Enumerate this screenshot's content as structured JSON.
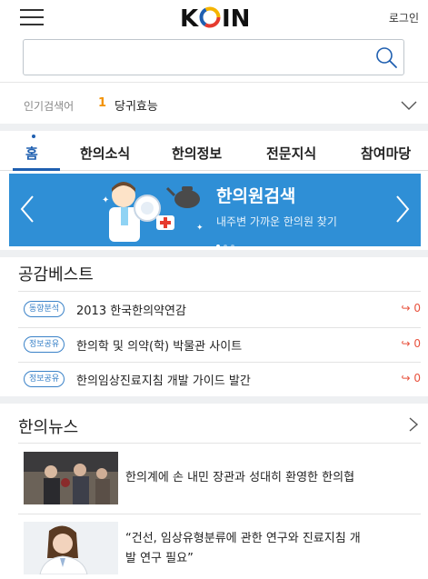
{
  "header": {
    "logo_text": "KOIN",
    "login_label": "로그인"
  },
  "search": {
    "value": "",
    "placeholder": ""
  },
  "popular": {
    "label": "인기검색어",
    "rank": "1",
    "term": "당귀효능"
  },
  "tabs": [
    {
      "label": "홈",
      "active": true
    },
    {
      "label": "한의소식"
    },
    {
      "label": "한의정보"
    },
    {
      "label": "전문지식"
    },
    {
      "label": "참여마당"
    }
  ],
  "banner": {
    "title": "한의원검색",
    "subtitle": "내주변 가까운 한의원 찾기",
    "color": "#2f8fd6"
  },
  "best": {
    "title": "공감베스트",
    "items": [
      {
        "badge": "동향분석",
        "text": "2013 한국한의약연감",
        "count": "0"
      },
      {
        "badge": "정보공유",
        "text": "한의학 및 의약(학) 박물관 사이트",
        "count": "0"
      },
      {
        "badge": "정보공유",
        "text": "한의임상진료지침 개발 가이드 발간",
        "count": "0"
      }
    ]
  },
  "news": {
    "title": "한의뉴스",
    "items": [
      {
        "text": "한의계에 손 내민 장관과 성대히 환영한 한의협"
      },
      {
        "line1": "“건선, 임상유형분류에 관한 연구와 진료지침 개",
        "line2": "발 연구 필요”"
      }
    ]
  },
  "colors": {
    "accent": "#1f5fb0",
    "orange": "#f39200",
    "share_count": "#e8523e"
  }
}
